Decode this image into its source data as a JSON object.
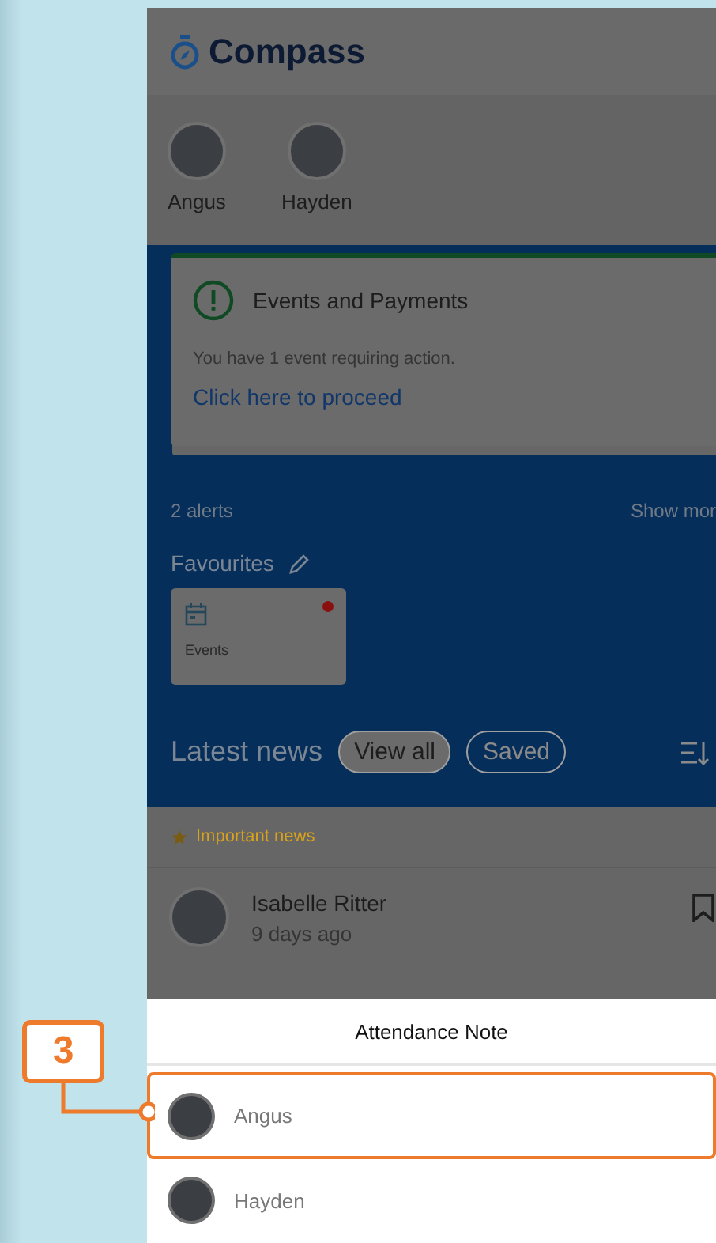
{
  "app": {
    "logo_text": "Compass"
  },
  "students": [
    {
      "name": "Angus"
    },
    {
      "name": "Hayden"
    }
  ],
  "alert_card": {
    "title": "Events and Payments",
    "message": "You have 1 event requiring action.",
    "link": "Click here to proceed"
  },
  "alerts": {
    "count": "2 alerts",
    "more": "Show mor"
  },
  "favourites": {
    "title": "Favourites",
    "items": [
      {
        "label": "Events",
        "unread": true
      }
    ]
  },
  "news": {
    "title": "Latest news",
    "filters": [
      {
        "label": "View all",
        "selected": true
      },
      {
        "label": "Saved",
        "selected": false
      }
    ],
    "important_label": "Important news",
    "post": {
      "author": "Isabelle Ritter",
      "time": "9 days ago"
    }
  },
  "sheet": {
    "title": "Attendance Note",
    "options": [
      {
        "name": "Angus",
        "highlighted": true
      },
      {
        "name": "Hayden",
        "highlighted": false
      }
    ]
  },
  "callout": {
    "label": "3"
  }
}
